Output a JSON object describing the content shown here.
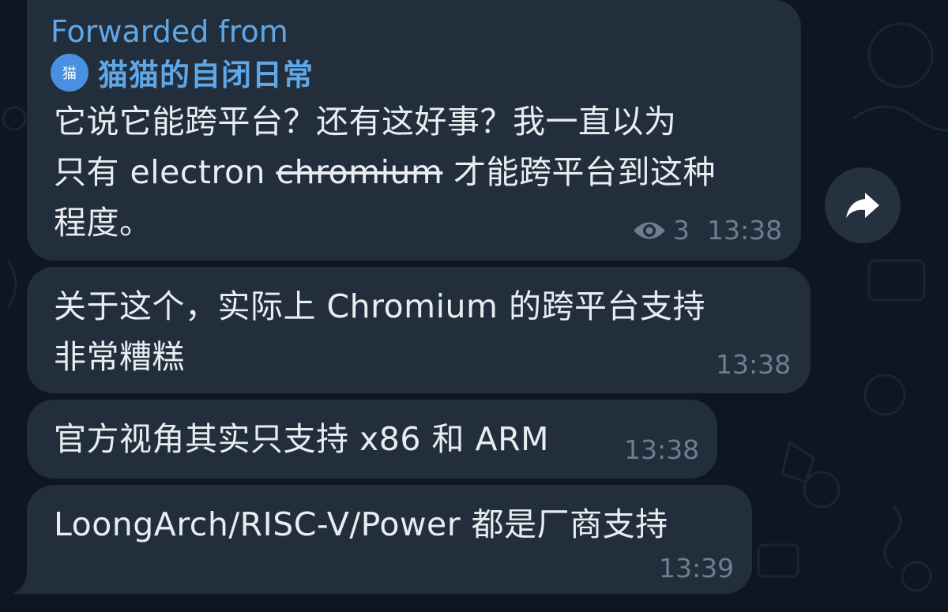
{
  "colors": {
    "background": "#0e1621",
    "bubble": "#222e3c",
    "accent": "#5fa7e6",
    "meta": "#6f7d8c"
  },
  "messages": [
    {
      "forwarded_label": "Forwarded from",
      "forwarded_avatar": "猫",
      "forwarded_name": "猫猫的自闭日常",
      "line1": "它说它能跨平台？还有这好事？我一直以为",
      "line2_prefix": "只有 electron",
      "line2_struck": "chromium",
      "line2_suffix": "才能跨平台到这种",
      "line3": "程度。",
      "view_icon": "eye-icon",
      "views": "3",
      "time": "13:38"
    },
    {
      "line1": "关于这个，实际上 Chromium 的跨平台支持",
      "line2": "非常糟糕",
      "time": "13:38"
    },
    {
      "line1": "官方视角其实只支持 x86 和 ARM",
      "time": "13:38"
    },
    {
      "line1": "LoongArch/RISC-V/Power 都是厂商支持",
      "time": "13:39"
    }
  ],
  "share_button_icon": "share-arrow-icon"
}
